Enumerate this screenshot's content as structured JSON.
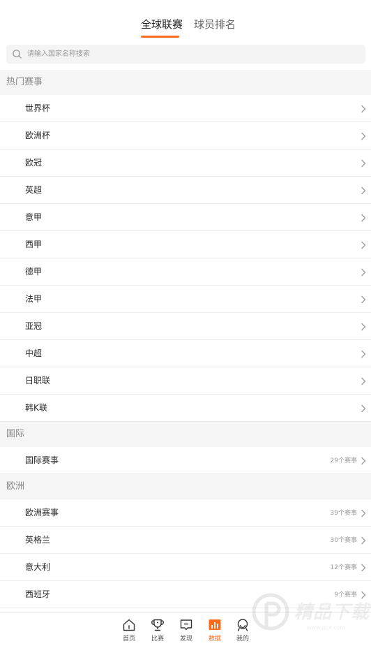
{
  "tabs": [
    {
      "label": "全球联赛",
      "active": true
    },
    {
      "label": "球员排名",
      "active": false
    }
  ],
  "search": {
    "placeholder": "请输入国家名称搜索",
    "icon": "search-icon"
  },
  "sections": [
    {
      "title": "热门赛事",
      "items": [
        {
          "label": "世界杯"
        },
        {
          "label": "欧洲杯"
        },
        {
          "label": "欧冠"
        },
        {
          "label": "英超"
        },
        {
          "label": "意甲"
        },
        {
          "label": "西甲"
        },
        {
          "label": "德甲"
        },
        {
          "label": "法甲"
        },
        {
          "label": "亚冠"
        },
        {
          "label": "中超"
        },
        {
          "label": "日职联"
        },
        {
          "label": "韩K联"
        }
      ]
    },
    {
      "title": "国际",
      "items": [
        {
          "label": "国际赛事",
          "count": "29个赛事"
        }
      ]
    },
    {
      "title": "欧洲",
      "items": [
        {
          "label": "欧洲赛事",
          "count": "39个赛事"
        },
        {
          "label": "英格兰",
          "count": "30个赛事"
        },
        {
          "label": "意大利",
          "count": "12个赛事"
        },
        {
          "label": "西班牙",
          "count": "9个赛事"
        }
      ]
    }
  ],
  "bottom_nav": [
    {
      "label": "首页",
      "icon": "home-icon",
      "active": false
    },
    {
      "label": "比赛",
      "icon": "trophy-icon",
      "active": false
    },
    {
      "label": "发现",
      "icon": "discover-icon",
      "active": false
    },
    {
      "label": "数据",
      "icon": "data-chart-icon",
      "active": true
    },
    {
      "label": "我的",
      "icon": "profile-icon",
      "active": false
    }
  ],
  "colors": {
    "accent": "#ff6a1a",
    "text": "#222222",
    "muted": "#888888",
    "section_bg": "#f5f5f5"
  },
  "watermark": {
    "text": "精品下载",
    "url": "www.jpjx.com"
  }
}
